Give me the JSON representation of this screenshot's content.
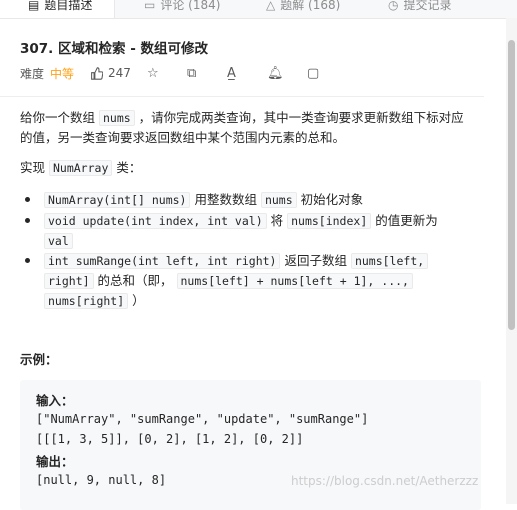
{
  "tabs": [
    {
      "icon": "document-icon",
      "label": "题目描述"
    },
    {
      "icon": "comment-icon",
      "label": "评论 (184)"
    },
    {
      "icon": "flask-icon",
      "label": "题解 (168)"
    },
    {
      "icon": "clock-icon",
      "label": "提交记录"
    }
  ],
  "problem": {
    "title": "307. 区域和检索 - 数组可修改",
    "difficulty_label": "难度",
    "difficulty": "中等",
    "likes": "247"
  },
  "description": {
    "p1a": "给你一个数组 ",
    "p1code": "nums",
    "p1b": " ，请你完成两类查询，其中一类查询要求更新数组下标对应",
    "p1c": "的值，另一类查询要求返回数组中某个范围内元素的总和。",
    "p2a": "实现 ",
    "p2code": "NumArray",
    "p2b": " 类："
  },
  "features": [
    {
      "code": "NumArray(int[] nums)",
      "text1": " 用整数数组 ",
      "code2": "nums",
      "text2": " 初始化对象"
    },
    {
      "code": "void update(int index, int val)",
      "text1": " 将 ",
      "code2": "nums[index]",
      "text2": " 的值更新为",
      "code3": "val"
    },
    {
      "code": "int sumRange(int left, int right)",
      "text1": " 返回子数组 ",
      "code2": "nums[left,",
      "code3": "right]",
      "text2": " 的总和（即， ",
      "code4": "nums[left] + nums[left + 1], ...,",
      "code5": "nums[right]",
      "text3": " ）"
    }
  ],
  "example": {
    "heading": "示例：",
    "input_label": "输入：",
    "input_line1": "[\"NumArray\", \"sumRange\", \"update\", \"sumRange\"]",
    "input_line2": "[[[1, 3, 5]], [0, 2], [1, 2], [0, 2]]",
    "output_label": "输出：",
    "output_line": "[null, 9, null, 8]"
  },
  "watermark": "https://blog.csdn.net/Aetherzzz"
}
